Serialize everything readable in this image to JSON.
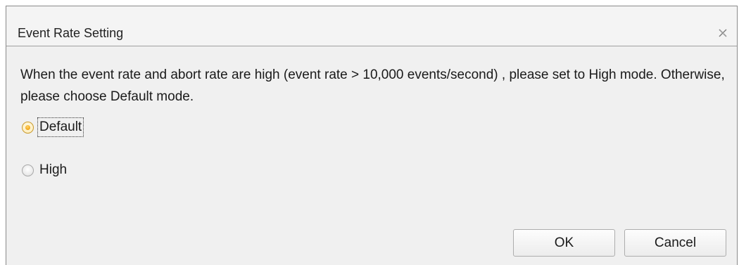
{
  "dialog": {
    "title": "Event Rate Setting",
    "close_icon": "close-icon",
    "message": "When the event rate and abort rate are high (event rate > 10,000 events/second) , please set to High mode. Otherwise, please choose Default mode.",
    "options": [
      {
        "label": "Default",
        "selected": true
      },
      {
        "label": "High",
        "selected": false
      }
    ],
    "buttons": {
      "ok_label": "OK",
      "cancel_label": "Cancel"
    },
    "colors": {
      "radio_selected": "#f2a515",
      "background": "#f0f0f0"
    }
  }
}
